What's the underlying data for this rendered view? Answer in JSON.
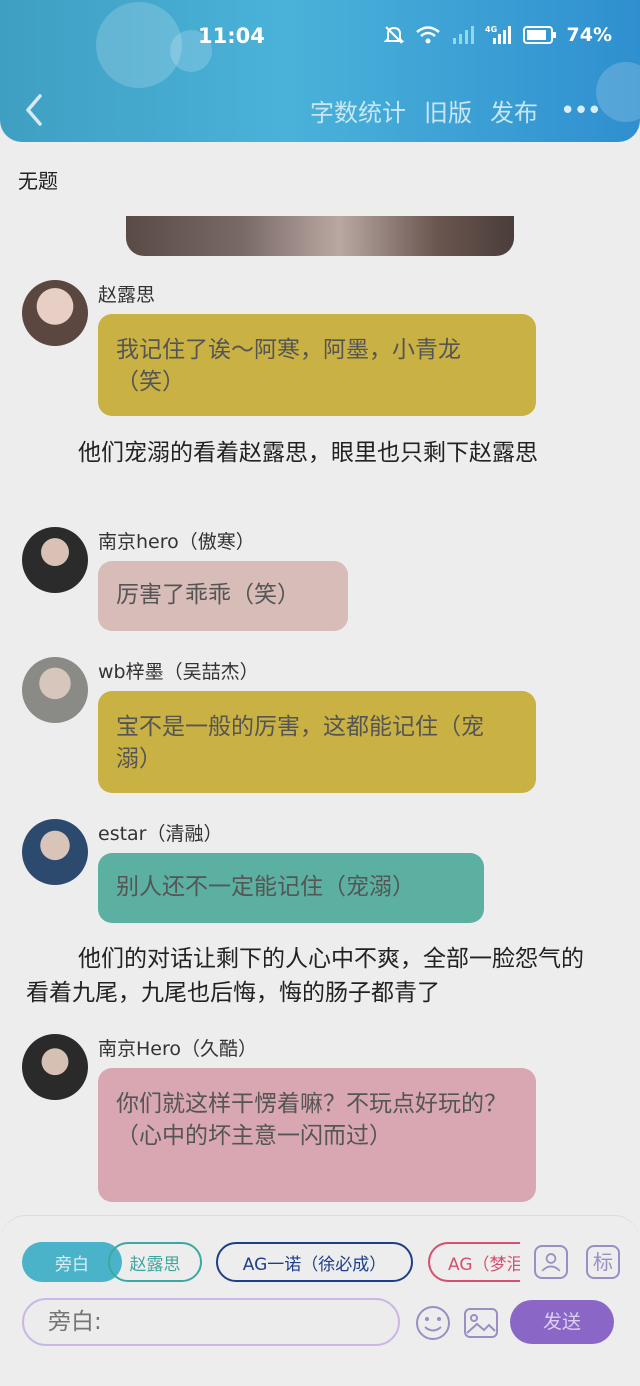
{
  "status_bar": {
    "time": "11:04",
    "battery": "74%",
    "network": "4G"
  },
  "nav": {
    "actions": [
      "字数统计",
      "旧版",
      "发布"
    ],
    "more": "•••"
  },
  "document": {
    "title": "无题"
  },
  "messages": [
    {
      "speaker": "赵露思",
      "text": "我记住了诶～阿寒，阿墨，小青龙（笑）",
      "color": "#c9b243"
    },
    {
      "narration": "他们宠溺的看着赵露思，眼里也只剩下赵露思"
    },
    {
      "speaker": "南京hero（傲寒）",
      "text": "厉害了乖乖（笑）",
      "color": "#d7bcb8"
    },
    {
      "speaker": "wb梓墨（吴喆杰）",
      "text": "宝不是一般的厉害，这都能记住（宠溺）",
      "color": "#c9b243"
    },
    {
      "speaker": "estar（清融）",
      "text": "别人还不一定能记住（宠溺）",
      "color": "#5cb0a1"
    },
    {
      "narration": "他们的对话让剩下的人心中不爽，全部一脸怨气的看着九尾，九尾也后悔，悔的肠子都青了"
    },
    {
      "speaker": "南京Hero（久酷）",
      "text": "你们就这样干愣着嘛？不玩点好玩的？（心中的坏主意一闪而过）",
      "color": "#d9a7b1"
    }
  ],
  "role_chips": [
    {
      "label": "旁白",
      "active": true,
      "color": "#4ab2c9"
    },
    {
      "label": "赵露思",
      "active": false,
      "color": "#3ea8a0"
    },
    {
      "label": "AG一诺（徐必成）",
      "active": false,
      "color": "#1d3f8a"
    },
    {
      "label": "AG（梦泪）",
      "active": false,
      "color": "#d6506e"
    }
  ],
  "input": {
    "placeholder": "旁白:"
  },
  "send_label": "发送",
  "side_icons": {
    "role": "person-icon",
    "tag_label": "标"
  }
}
